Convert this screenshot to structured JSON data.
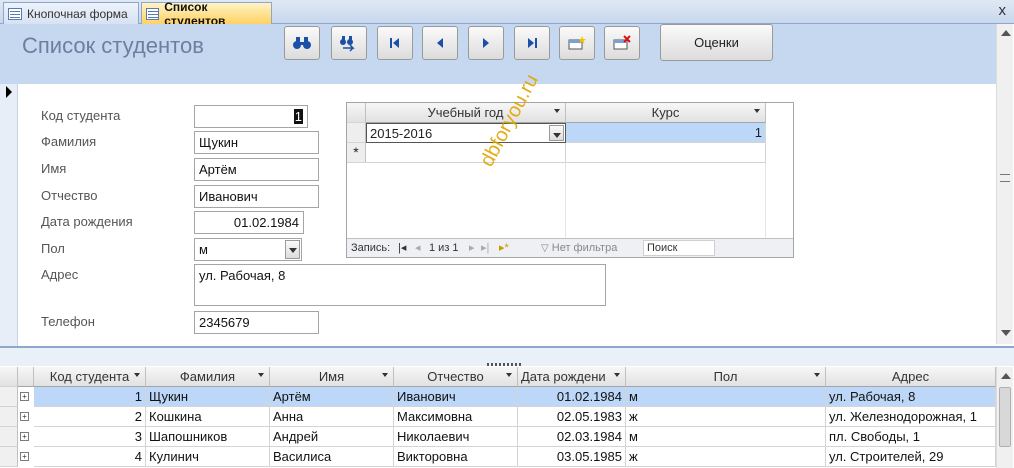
{
  "tabs": [
    {
      "label": "Кнопочная форма",
      "active": false
    },
    {
      "label": "Список студентов",
      "active": true
    }
  ],
  "close_glyph": "x",
  "header": {
    "title": "Список студентов",
    "grades_button": "Оценки"
  },
  "toolbar_icons": [
    "find-icon",
    "find-next-icon",
    "first-record-icon",
    "previous-record-icon",
    "next-record-icon",
    "last-record-icon",
    "new-record-icon",
    "delete-record-icon"
  ],
  "fields": {
    "student_id": {
      "label": "Код студента",
      "value": "1"
    },
    "last_name": {
      "label": "Фамилия",
      "value": "Щукин"
    },
    "first_name": {
      "label": "Имя",
      "value": "Артём"
    },
    "patronymic": {
      "label": "Отчество",
      "value": "Иванович"
    },
    "birth_date": {
      "label": "Дата рождения",
      "value": "01.02.1984"
    },
    "gender": {
      "label": "Пол",
      "value": "м"
    },
    "address": {
      "label": "Адрес",
      "value": "ул. Рабочая, 8"
    },
    "phone": {
      "label": "Телефон",
      "value": "2345679"
    }
  },
  "subform": {
    "columns": [
      "Учебный год",
      "Курс"
    ],
    "rows": [
      {
        "year": "2015-2016",
        "course": "1"
      }
    ],
    "nav": {
      "record_label": "Запись:",
      "position": "1 из 1",
      "filter": "Нет фильтра",
      "search": "Поиск"
    }
  },
  "datasheet": {
    "columns": [
      "Код студента",
      "Фамилия",
      "Имя",
      "Отчество",
      "Дата рождени",
      "Пол",
      "Адрес"
    ],
    "rows": [
      [
        "1",
        "Щукин",
        "Артём",
        "Иванович",
        "01.02.1984",
        "м",
        "ул. Рабочая, 8"
      ],
      [
        "2",
        "Кошкина",
        "Анна",
        "Максимовна",
        "02.05.1983",
        "ж",
        "ул. Железнодорожная, 1"
      ],
      [
        "3",
        "Шапошников",
        "Андрей",
        "Николаевич",
        "02.03.1984",
        "м",
        "пл. Свободы, 1"
      ],
      [
        "4",
        "Кулинич",
        "Василиса",
        "Викторовна",
        "03.05.1985",
        "ж",
        "ул. Строителей, 29"
      ]
    ]
  },
  "watermark": "dbforyou.ru",
  "colors": {
    "header_bg": "#c6d8f0",
    "active_tab": "#ffd05e",
    "selected_row": "#bcd7f7",
    "watermark": "#e0a400"
  }
}
